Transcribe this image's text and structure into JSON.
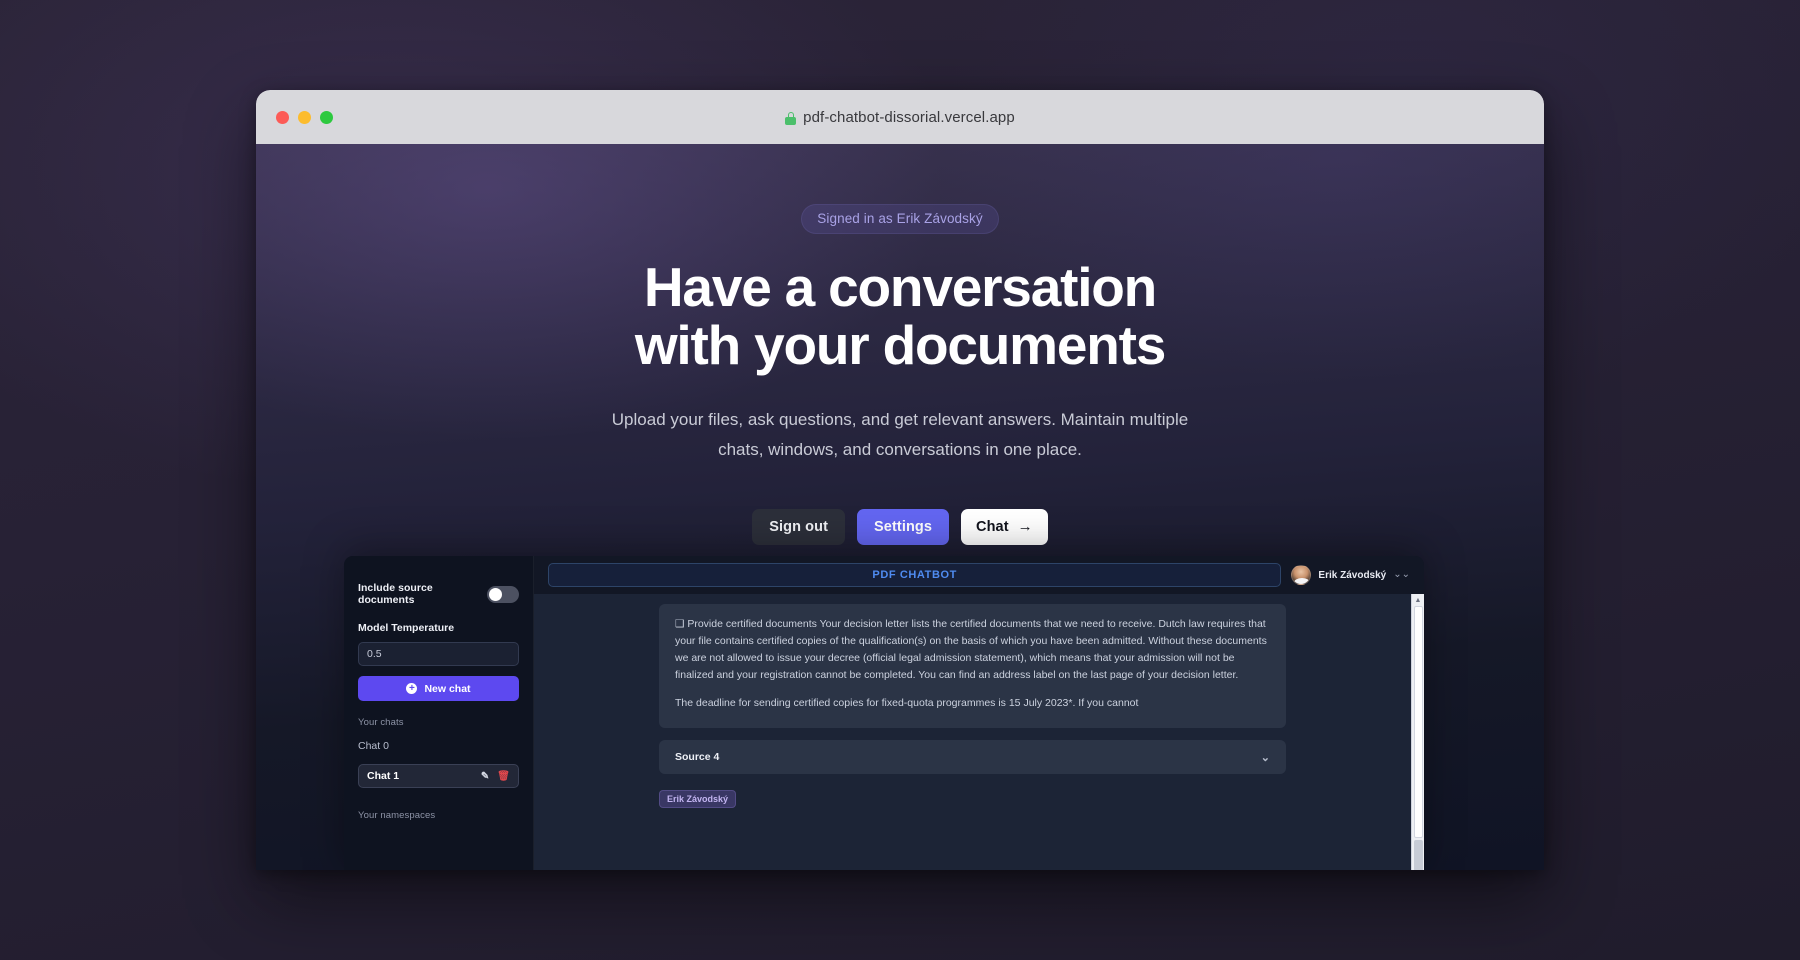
{
  "browser": {
    "url": "pdf-chatbot-dissorial.vercel.app",
    "lock_icon": "lock-icon",
    "traffic_lights": [
      "close-red",
      "minimize-yellow",
      "maximize-green"
    ]
  },
  "hero": {
    "badge": "Signed in as Erik Závodský",
    "title_line_1": "Have a conversation",
    "title_line_2": "with your documents",
    "subtitle": "Upload your files, ask questions, and get relevant answers. Maintain multiple chats, windows, and conversations in one place."
  },
  "cta": {
    "sign_out": "Sign out",
    "settings": "Settings",
    "chat": "Chat",
    "chat_arrow": "→"
  },
  "preview": {
    "sidebar": {
      "include_sources_label": "Include source documents",
      "include_sources_on": false,
      "model_temperature_label": "Model Temperature",
      "model_temperature_value": "0.5",
      "new_chat_label": "New chat",
      "new_chat_plus": "+",
      "your_chats_label": "Your chats",
      "chats": [
        {
          "label": "Chat 0",
          "active": false
        },
        {
          "label": "Chat 1",
          "active": true
        }
      ],
      "chat_0_label": "Chat 0",
      "chat_1_label": "Chat 1",
      "edit_icon": "✎",
      "delete_icon": "🗑",
      "your_namespaces_label": "Your namespaces"
    },
    "topbar": {
      "app_title": "PDF CHATBOT",
      "user_name": "Erik Závodský",
      "chevron": "⌄⌄"
    },
    "message": {
      "paragraph_1": "❑ Provide certified documents Your decision letter lists the certified documents that we need to receive. Dutch law requires that your file contains certified copies of the qualification(s) on the basis of which you have been admitted. Without these documents we are not allowed to issue your decree (official legal admission statement), which means that your admission will not be finalized and your registration cannot be completed. You can find an address label on the last page of your decision letter.",
      "paragraph_2": "The deadline for sending certified copies for fixed-quota programmes is 15 July 2023*. If you cannot"
    },
    "source": {
      "label": "Source 4",
      "chevron": "⌄"
    },
    "user_tag": "Erik Závodský",
    "scrollbar": {
      "up_arrow": "▲"
    }
  },
  "colors": {
    "accent_indigo": "#6366f1",
    "new_chat_purple": "#5d49f0",
    "app_title_blue": "#4f8bf0",
    "badge_text": "#a9a2e6",
    "delete_red": "#e0474c"
  }
}
